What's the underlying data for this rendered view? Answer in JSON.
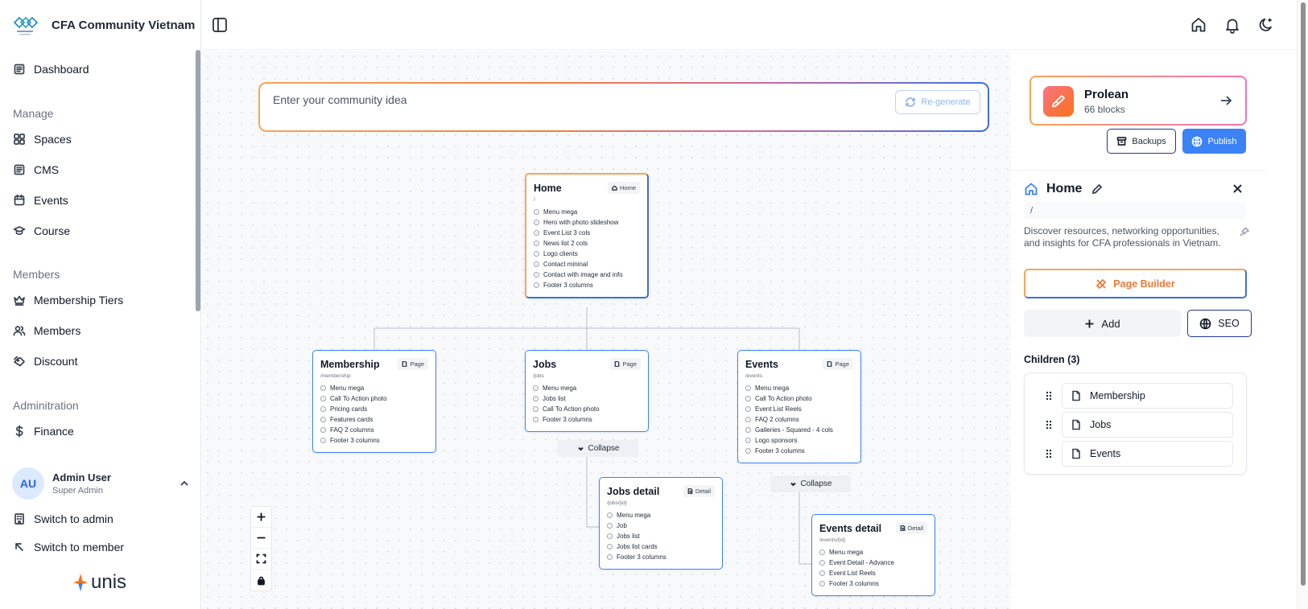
{
  "app": {
    "name": "CFA Community Vietnam",
    "logo_icon": "cfa-logo-icon"
  },
  "sidebar": {
    "dashboard": "Dashboard",
    "manage_label": "Manage",
    "manage_items": [
      "Spaces",
      "CMS",
      "Events",
      "Course"
    ],
    "members_label": "Members",
    "members_items": [
      "Membership Tiers",
      "Members",
      "Discount"
    ],
    "admin_label": "Adminitration",
    "admin_items": [
      "Finance"
    ],
    "user": {
      "initials": "AU",
      "name": "Admin User",
      "role": "Super Admin"
    },
    "switch_admin": "Switch to admin",
    "switch_member": "Switch to member",
    "footer_brand": "unis"
  },
  "prompt": {
    "placeholder": "Enter your community idea",
    "regenerate": "Re-generate"
  },
  "nodes": {
    "home": {
      "title": "Home",
      "badge": "Home",
      "path": "/",
      "items": [
        "Menu mega",
        "Hero with photo slideshow",
        "Event List 3 cols",
        "News list 2 cols",
        "Logo clients",
        "Contact mininal",
        "Contact with image and info",
        "Footer 3 columns"
      ]
    },
    "membership": {
      "title": "Membership",
      "badge": "Page",
      "path": "/membership",
      "items": [
        "Menu mega",
        "Call To Action photo",
        "Pricing cards",
        "Features cards",
        "FAQ 2 columns",
        "Footer 3 columns"
      ]
    },
    "jobs": {
      "title": "Jobs",
      "badge": "Page",
      "path": "/jobs",
      "items": [
        "Menu mega",
        "Jobs list",
        "Call To Action photo",
        "Footer 3 columns"
      ]
    },
    "events": {
      "title": "Events",
      "badge": "Page",
      "path": "/events",
      "items": [
        "Menu mega",
        "Call To Action photo",
        "Event List Reels",
        "FAQ 2 columns",
        "Galleries - Squared - 4 cols",
        "Logo sponsors",
        "Footer 3 columns"
      ]
    },
    "jobs_detail": {
      "title": "Jobs detail",
      "badge": "Detail",
      "path": "/jobs/{id}",
      "items": [
        "Menu mega",
        "Job",
        "Jobs list",
        "Jobs list cards",
        "Footer 3 columns"
      ]
    },
    "events_detail": {
      "title": "Events detail",
      "badge": "Detail",
      "path": "/events/{id}",
      "items": [
        "Menu mega",
        "Event Detail - Advance",
        "Event List Reels",
        "Footer 3 columns"
      ]
    }
  },
  "collapse_label": "Collapse",
  "panel": {
    "project_name": "Prolean",
    "project_blocks": "66 blocks",
    "backups": "Backups",
    "publish": "Publish",
    "page_title": "Home",
    "slug": "/",
    "description": "Discover resources, networking opportunities, and insights for CFA professionals in Vietnam.",
    "page_builder": "Page Builder",
    "add": "Add",
    "seo": "SEO",
    "children_label": "Children (3)",
    "children": [
      "Membership",
      "Jobs",
      "Events"
    ]
  },
  "colors": {
    "accent": "#3b82f6",
    "orange": "#f6a45a",
    "text": "#111827"
  }
}
